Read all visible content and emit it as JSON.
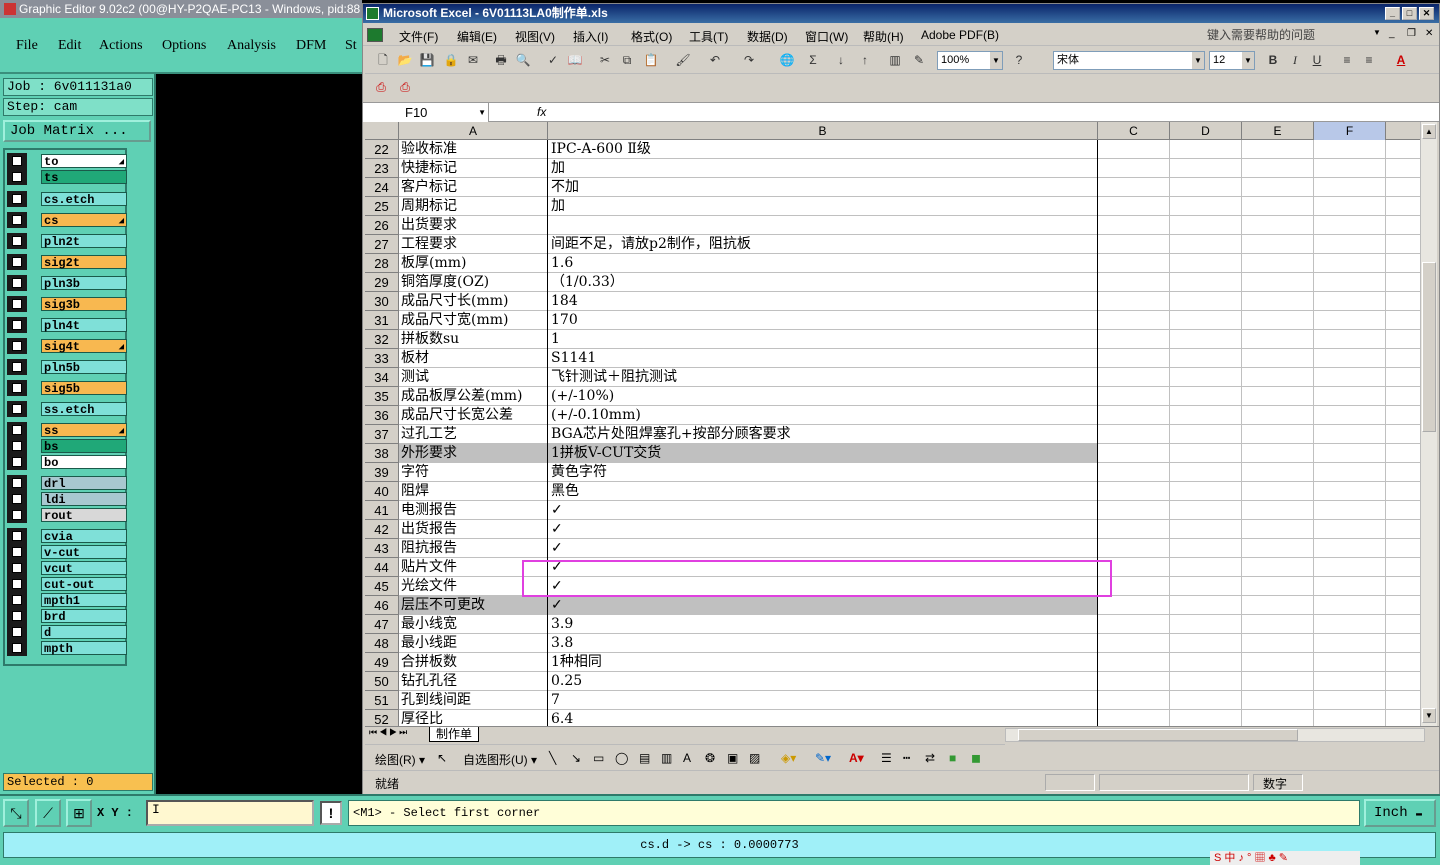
{
  "graphic_editor": {
    "title": "Graphic Editor 9.02c2 (00@HY-P2QAE-PC13 - Windows, pid:88",
    "menu": [
      "File",
      "Edit",
      "Actions",
      "Options",
      "Analysis",
      "DFM",
      "St"
    ],
    "job_label": "Job  :  6v011131a0",
    "step_label": "Step:  cam",
    "job_matrix_label": "Job Matrix ...",
    "layers": [
      {
        "name": "to",
        "color": "#ffffff",
        "arrow": true
      },
      {
        "name": "ts",
        "color": "#20a878",
        "arrow": false
      },
      {
        "name": "cs.etch",
        "color": "#7fe0d8",
        "arrow": false
      },
      {
        "name": "cs",
        "color": "#f8b850",
        "arrow": true
      },
      {
        "name": "pln2t",
        "color": "#7fe0d8",
        "arrow": false
      },
      {
        "name": "sig2t",
        "color": "#f8b850",
        "arrow": false
      },
      {
        "name": "pln3b",
        "color": "#7fe0d8",
        "arrow": false
      },
      {
        "name": "sig3b",
        "color": "#f8b850",
        "arrow": false
      },
      {
        "name": "pln4t",
        "color": "#7fe0d8",
        "arrow": false
      },
      {
        "name": "sig4t",
        "color": "#f8b850",
        "arrow": true
      },
      {
        "name": "pln5b",
        "color": "#7fe0d8",
        "arrow": false
      },
      {
        "name": "sig5b",
        "color": "#f8b850",
        "arrow": false
      },
      {
        "name": "ss.etch",
        "color": "#7fe0d8",
        "arrow": false
      },
      {
        "name": "ss",
        "color": "#f8b850",
        "arrow": true
      },
      {
        "name": "bs",
        "color": "#20a878",
        "arrow": false
      },
      {
        "name": "bo",
        "color": "#ffffff",
        "arrow": false
      },
      {
        "name": "drl",
        "color": "#a8c8d0",
        "arrow": false
      },
      {
        "name": "ldi",
        "color": "#a8c8d0",
        "arrow": false
      },
      {
        "name": "rout",
        "color": "#d8d8d8",
        "arrow": false
      },
      {
        "name": "cvia",
        "color": "#7fe0d8",
        "arrow": false
      },
      {
        "name": "v-cut",
        "color": "#7fe0d8",
        "arrow": false
      },
      {
        "name": "vcut",
        "color": "#7fe0d8",
        "arrow": false
      },
      {
        "name": "cut-out",
        "color": "#7fe0d8",
        "arrow": false
      },
      {
        "name": "mpth1",
        "color": "#7fe0d8",
        "arrow": false
      },
      {
        "name": "brd",
        "color": "#7fe0d8",
        "arrow": false
      },
      {
        "name": "d",
        "color": "#7fe0d8",
        "arrow": false
      },
      {
        "name": "mpth",
        "color": "#7fe0d8",
        "arrow": false
      }
    ],
    "selected_label": "Selected : 0",
    "xy_label": "X Y :",
    "xy_value": "I",
    "bang": "!",
    "prompt": "<M1> - Select first corner",
    "units": "Inch",
    "units_arrow": "▬",
    "status_message": "cs.d -> cs : 0.0000773",
    "ime": "S 中 ♪ ° ▦ ♣ ✎"
  },
  "excel": {
    "title": "Microsoft Excel - 6V01113LA0制作单.xls",
    "menu": [
      "文件(F)",
      "编辑(E)",
      "视图(V)",
      "插入(I)",
      "格式(O)",
      "工具(T)",
      "数据(D)",
      "窗口(W)",
      "帮助(H)",
      "Adobe PDF(B)"
    ],
    "help_placeholder": "键入需要帮助的问题",
    "zoom": "100%",
    "font_name": "宋体",
    "font_size": "12",
    "cell_ref": "F10",
    "fx": "fx",
    "columns": [
      "A",
      "B",
      "C",
      "D",
      "E",
      "F"
    ],
    "rows": [
      {
        "n": "22",
        "a": "验收标准",
        "b": "IPC-A-600 Ⅱ级"
      },
      {
        "n": "23",
        "a": "快捷标记",
        "b": "加"
      },
      {
        "n": "24",
        "a": "客户标记",
        "b": "不加"
      },
      {
        "n": "25",
        "a": "周期标记",
        "b": "加"
      },
      {
        "n": "26",
        "a": "出货要求",
        "b": ""
      },
      {
        "n": "27",
        "a": "工程要求",
        "b": "间距不足，请放p2制作，阻抗板"
      },
      {
        "n": "28",
        "a": "板厚(mm)",
        "b": "1.6"
      },
      {
        "n": "29",
        "a": "铜箔厚度(OZ)",
        "b": "（1/0.33）"
      },
      {
        "n": "30",
        "a": "成品尺寸长(mm)",
        "b": "184"
      },
      {
        "n": "31",
        "a": "成品尺寸宽(mm)",
        "b": "170"
      },
      {
        "n": "32",
        "a": "拼板数su",
        "b": "1"
      },
      {
        "n": "33",
        "a": "板材",
        "b": "S1141"
      },
      {
        "n": "34",
        "a": "测试",
        "b": "飞针测试＋阻抗测试"
      },
      {
        "n": "35",
        "a": "成品板厚公差(mm)",
        "b": "(+/-10%)"
      },
      {
        "n": "36",
        "a": "成品尺寸长宽公差",
        "b": "(+/-0.10mm)"
      },
      {
        "n": "37",
        "a": "过孔工艺",
        "b": "BGA芯片处阻焊塞孔+按部分顾客要求"
      },
      {
        "n": "38",
        "a": "外形要求",
        "b": "1拼板V-CUT交货",
        "grey": true
      },
      {
        "n": "39",
        "a": "字符",
        "b": "黄色字符"
      },
      {
        "n": "40",
        "a": "阻焊",
        "b": "黑色"
      },
      {
        "n": "41",
        "a": "电测报告",
        "b": "✓"
      },
      {
        "n": "42",
        "a": "出货报告",
        "b": "✓"
      },
      {
        "n": "43",
        "a": "阻抗报告",
        "b": "✓"
      },
      {
        "n": "44",
        "a": "贴片文件",
        "b": "✓"
      },
      {
        "n": "45",
        "a": "光绘文件",
        "b": "✓"
      },
      {
        "n": "46",
        "a": "层压不可更改",
        "b": "✓",
        "grey": true
      },
      {
        "n": "47",
        "a": "最小线宽",
        "b": "3.9"
      },
      {
        "n": "48",
        "a": "最小线距",
        "b": "3.8"
      },
      {
        "n": "49",
        "a": "合拼板数",
        "b": "1种相同"
      },
      {
        "n": "50",
        "a": "钻孔孔径",
        "b": "0.25"
      },
      {
        "n": "51",
        "a": "孔到线间距",
        "b": "7"
      },
      {
        "n": "52",
        "a": "厚径比",
        "b": "6.4"
      }
    ],
    "sheet_tab": "制作单",
    "draw_label": "绘图(R) ▾",
    "autoshape_label": "自选图形(U) ▾",
    "status_ready": "就绪",
    "status_num": "数字"
  }
}
